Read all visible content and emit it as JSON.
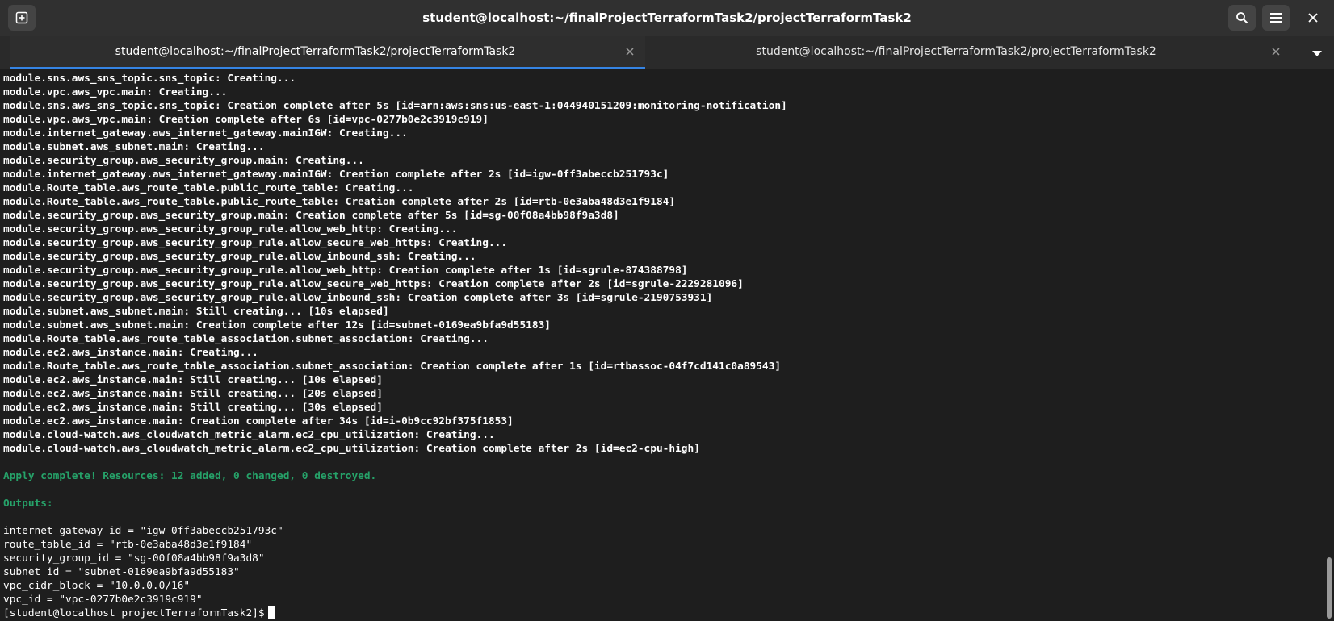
{
  "window": {
    "title": "student@localhost:~/finalProjectTerraformTask2/projectTerraformTask2",
    "new_tab_icon": "new-tab-icon",
    "search_icon": "search-icon",
    "menu_icon": "hamburger-menu-icon",
    "close_icon": "close-icon"
  },
  "tabs": [
    {
      "label": "student@localhost:~/finalProjectTerraformTask2/projectTerraformTask2",
      "active": true
    },
    {
      "label": "student@localhost:~/finalProjectTerraformTask2/projectTerraformTask2",
      "active": false
    }
  ],
  "colors": {
    "accent": "#3584e4",
    "success_text": "#26a269",
    "background": "#1e1e1e",
    "header": "#303030"
  },
  "terminal": {
    "log_lines": [
      "module.sns.aws_sns_topic.sns_topic: Creating...",
      "module.vpc.aws_vpc.main: Creating...",
      "module.sns.aws_sns_topic.sns_topic: Creation complete after 5s [id=arn:aws:sns:us-east-1:044940151209:monitoring-notification]",
      "module.vpc.aws_vpc.main: Creation complete after 6s [id=vpc-0277b0e2c3919c919]",
      "module.internet_gateway.aws_internet_gateway.mainIGW: Creating...",
      "module.subnet.aws_subnet.main: Creating...",
      "module.security_group.aws_security_group.main: Creating...",
      "module.internet_gateway.aws_internet_gateway.mainIGW: Creation complete after 2s [id=igw-0ff3abeccb251793c]",
      "module.Route_table.aws_route_table.public_route_table: Creating...",
      "module.Route_table.aws_route_table.public_route_table: Creation complete after 2s [id=rtb-0e3aba48d3e1f9184]",
      "module.security_group.aws_security_group.main: Creation complete after 5s [id=sg-00f08a4bb98f9a3d8]",
      "module.security_group.aws_security_group_rule.allow_web_http: Creating...",
      "module.security_group.aws_security_group_rule.allow_secure_web_https: Creating...",
      "module.security_group.aws_security_group_rule.allow_inbound_ssh: Creating...",
      "module.security_group.aws_security_group_rule.allow_web_http: Creation complete after 1s [id=sgrule-874388798]",
      "module.security_group.aws_security_group_rule.allow_secure_web_https: Creation complete after 2s [id=sgrule-2229281096]",
      "module.security_group.aws_security_group_rule.allow_inbound_ssh: Creation complete after 3s [id=sgrule-2190753931]",
      "module.subnet.aws_subnet.main: Still creating... [10s elapsed]",
      "module.subnet.aws_subnet.main: Creation complete after 12s [id=subnet-0169ea9bfa9d55183]",
      "module.Route_table.aws_route_table_association.subnet_association: Creating...",
      "module.ec2.aws_instance.main: Creating...",
      "module.Route_table.aws_route_table_association.subnet_association: Creation complete after 1s [id=rtbassoc-04f7cd141c0a89543]",
      "module.ec2.aws_instance.main: Still creating... [10s elapsed]",
      "module.ec2.aws_instance.main: Still creating... [20s elapsed]",
      "module.ec2.aws_instance.main: Still creating... [30s elapsed]",
      "module.ec2.aws_instance.main: Creation complete after 34s [id=i-0b9cc92bf375f1853]",
      "module.cloud-watch.aws_cloudwatch_metric_alarm.ec2_cpu_utilization: Creating...",
      "module.cloud-watch.aws_cloudwatch_metric_alarm.ec2_cpu_utilization: Creation complete after 2s [id=ec2-cpu-high]"
    ],
    "apply_message": "Apply complete! Resources: 12 added, 0 changed, 0 destroyed.",
    "outputs_header": "Outputs:",
    "outputs": [
      "internet_gateway_id = \"igw-0ff3abeccb251793c\"",
      "route_table_id = \"rtb-0e3aba48d3e1f9184\"",
      "security_group_id = \"sg-00f08a4bb98f9a3d8\"",
      "subnet_id = \"subnet-0169ea9bfa9d55183\"",
      "vpc_cidr_block = \"10.0.0.0/16\"",
      "vpc_id = \"vpc-0277b0e2c3919c919\""
    ],
    "prompt": "[student@localhost projectTerraformTask2]$"
  }
}
